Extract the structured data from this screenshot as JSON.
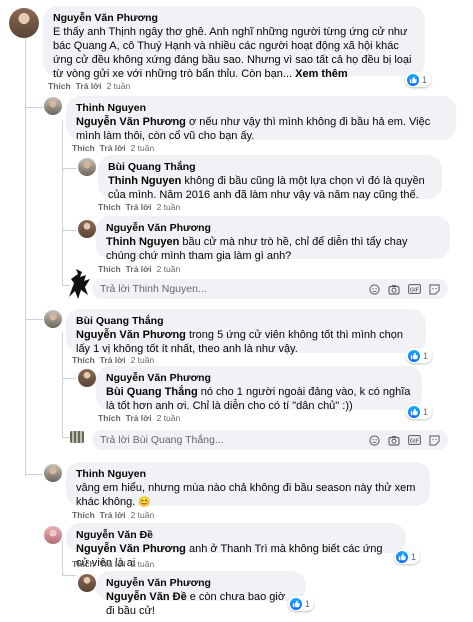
{
  "comments": [
    {
      "name": "Nguyễn Văn Phương",
      "text": "E thấy anh Thịnh ngây thơ ghê. Anh nghĩ những người từng ứng cử như bác Quang A, cô Thuý Hạnh và nhiều các người hoạt động xã hội khác ứng cử đều không xứng đáng bầu sao. Nhưng vì sao tất cả họ đều bị loại từ vòng gửi xe với những trò bẩn thỉu. Còn bạn...",
      "see_more": "Xem thêm",
      "like_label": "Thích",
      "reply_label": "Trả lời",
      "time": "2 tuần",
      "reaction_count": "1"
    },
    {
      "name": "Thinh Nguyen",
      "tag": "Nguyễn Văn Phương",
      "text": " ơ nếu như vậy thì mình không đi bầu hả em. Việc mình làm thôi, còn cổ vũ cho bạn ấy.",
      "like_label": "Thích",
      "reply_label": "Trả lời",
      "time": "2 tuần"
    },
    {
      "name": "Bùi Quang Thắng",
      "tag": "Thinh Nguyen",
      "text": " không đi bầu cũng là một lựa chọn vì đó là quyền của mình. Năm 2016 anh đã làm như vậy và năm nay cũng thế.",
      "like_label": "Thích",
      "reply_label": "Trả lời",
      "time": "2 tuần"
    },
    {
      "name": "Nguyễn Văn Phương",
      "tag": "Thinh Nguyen",
      "text": " bầu cử mà như trò hề, chỉ để diễn thì tẩy chay chúng chứ mình tham gia làm gì anh?",
      "like_label": "Thích",
      "reply_label": "Trả lời",
      "time": "2 tuần"
    },
    {
      "name": "Bùi Quang Thắng",
      "tag": "Nguyễn Văn Phương",
      "text": " trong 5 ứng cử viên không tốt thì mình chọn lấy 1 vị không tốt ít nhất, theo anh là như vậy.",
      "like_label": "Thích",
      "reply_label": "Trả lời",
      "time": "2 tuần",
      "reaction_count": "1"
    },
    {
      "name": "Nguyễn Văn Phương",
      "tag": "Bùi Quang Thắng",
      "text": " nó cho 1 người ngoài đảng vào, k có nghĩa là tốt hơn anh ơi. Chỉ là diễn cho có tí \"dân chủ\" :))",
      "like_label": "Thích",
      "reply_label": "Trả lời",
      "time": "2 tuần",
      "reaction_count": "1"
    },
    {
      "name": "Thinh Nguyen",
      "text": "vâng em hiểu, nhưng mùa nào chả không đi bầu season này thử xem khác không. ",
      "emoji": "😊",
      "like_label": "Thích",
      "reply_label": "Trả lời",
      "time": "2 tuần"
    },
    {
      "name": "Nguyễn Văn Đề",
      "tag": "Nguyễn Văn Phương",
      "text": " anh ở Thanh Trì mà không biết các ứng cử viên là ai",
      "like_label": "Thích",
      "reply_label": "Trả lời",
      "time": "2 tuần",
      "reaction_count": "1"
    },
    {
      "name": "Nguyễn Văn Phương",
      "tag": "Nguyễn Văn Đề",
      "text": " e còn chưa bao giờ đi bầu cử!",
      "reaction_count": "1"
    }
  ],
  "reply_boxes": [
    {
      "placeholder": "Trả lời Thinh Nguyen..."
    },
    {
      "placeholder": "Trả lời Bùi Quang Thắng..."
    }
  ],
  "colors": {
    "bubble": "#f0f2f5",
    "like_blue": "#0866ff",
    "muted": "#65676b"
  },
  "icons": [
    "like-icon",
    "emoji-icon",
    "camera-icon",
    "gif-icon",
    "sticker-icon"
  ]
}
